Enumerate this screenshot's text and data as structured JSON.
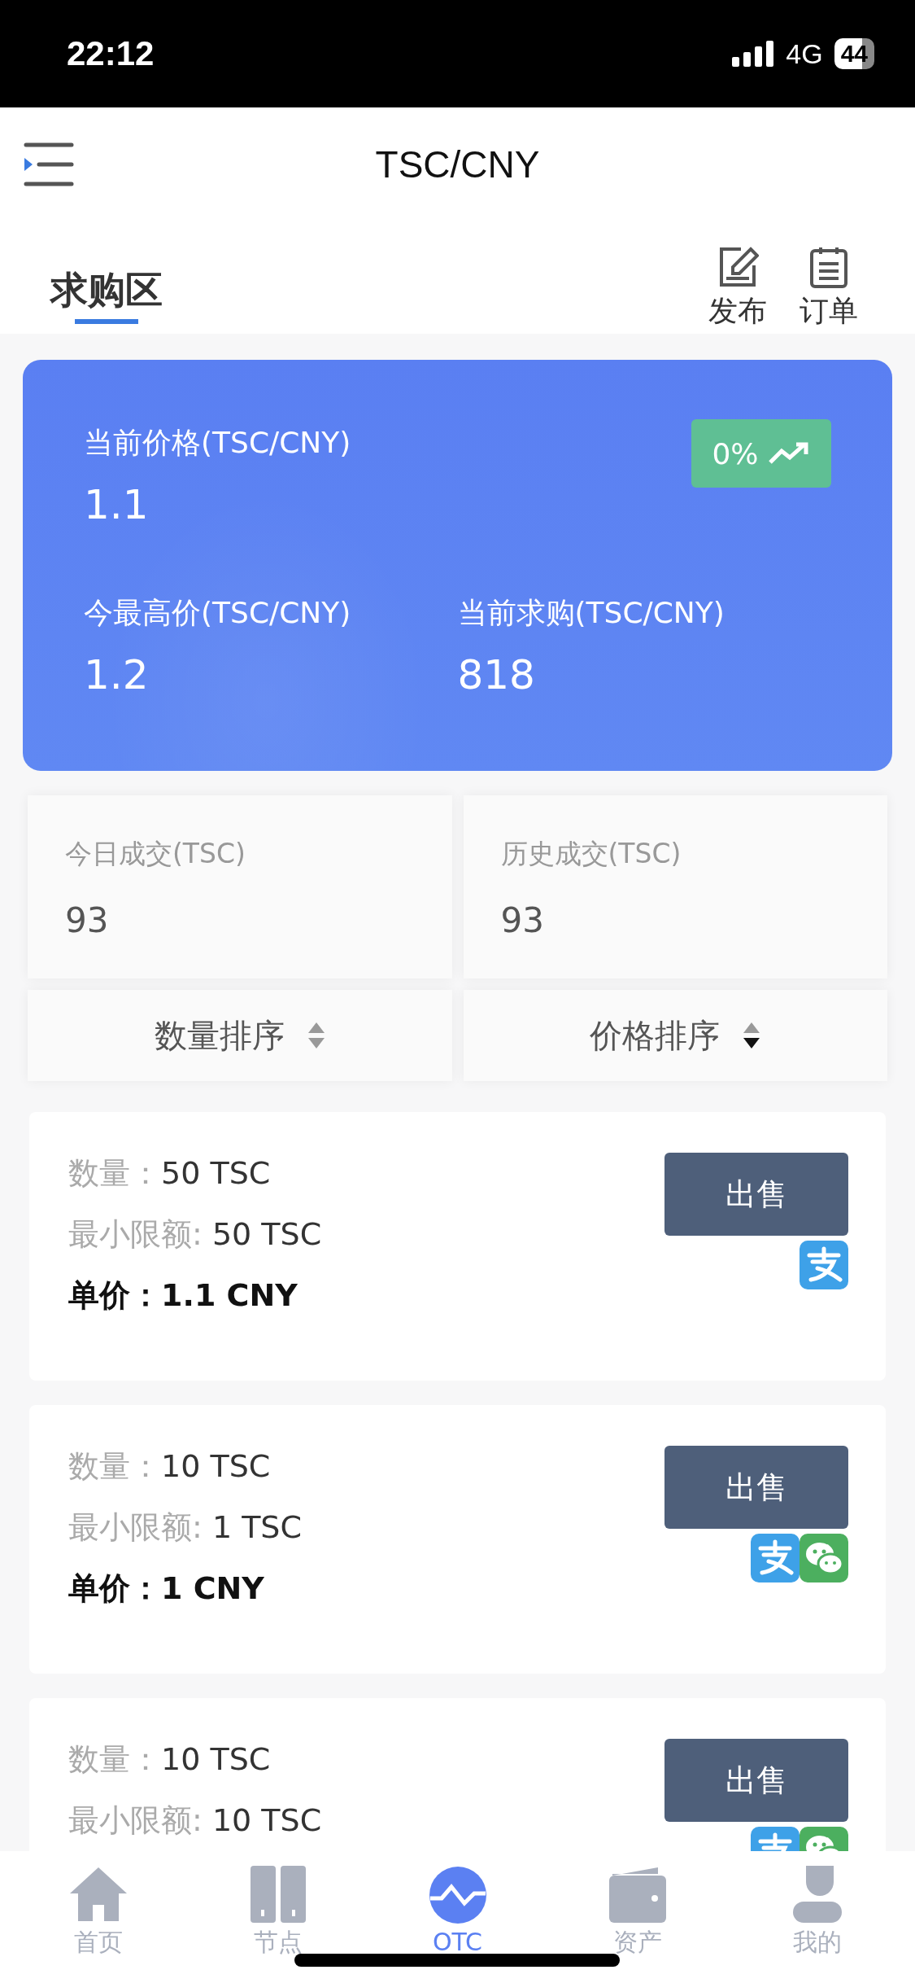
{
  "status_bar": {
    "time": "22:12",
    "network": "4G",
    "battery": "44"
  },
  "header": {
    "title": "TSC/CNY"
  },
  "tabs": [
    {
      "label": "求购区",
      "selected": true
    }
  ],
  "actions": [
    {
      "kind": "publish",
      "label": "发布"
    },
    {
      "kind": "orders",
      "label": "订单"
    }
  ],
  "price_card": {
    "current_label": "当前价格(TSC/CNY)",
    "current_value": "1.1",
    "change": "0%",
    "high_label": "今最高价(TSC/CNY)",
    "high_value": "1.2",
    "bid_label": "当前求购(TSC/CNY)",
    "bid_value": "818"
  },
  "stats": [
    {
      "label": "今日成交(TSC)",
      "value": "93"
    },
    {
      "label": "历史成交(TSC)",
      "value": "93"
    }
  ],
  "sorts": [
    {
      "label": "数量排序",
      "sorted": false
    },
    {
      "label": "价格排序",
      "sorted": true
    }
  ],
  "orders": [
    {
      "quantity_label": "数量：",
      "quantity": "50 TSC",
      "min_label": "最小限额:",
      "min": "50 TSC",
      "price": "单价：1.1 CNY",
      "button": "出售",
      "payments": [
        {
          "kind": "alipay"
        }
      ]
    },
    {
      "quantity_label": "数量：",
      "quantity": "10 TSC",
      "min_label": "最小限额:",
      "min": "1 TSC",
      "price": "单价：1 CNY",
      "button": "出售",
      "payments": [
        {
          "kind": "alipay"
        },
        {
          "kind": "wechat"
        }
      ]
    },
    {
      "quantity_label": "数量：",
      "quantity": "10 TSC",
      "min_label": "最小限额:",
      "min": "10 TSC",
      "button": "出售",
      "payments": [
        {
          "kind": "alipay"
        },
        {
          "kind": "wechat"
        }
      ]
    }
  ],
  "bottom_nav": [
    {
      "kind": "home",
      "label": "首页",
      "selected": false
    },
    {
      "kind": "node",
      "label": "节点",
      "selected": false
    },
    {
      "kind": "otc",
      "label": "OTC",
      "selected": true
    },
    {
      "kind": "wallet",
      "label": "资产",
      "selected": false
    },
    {
      "kind": "user",
      "label": "我的",
      "selected": false
    }
  ]
}
